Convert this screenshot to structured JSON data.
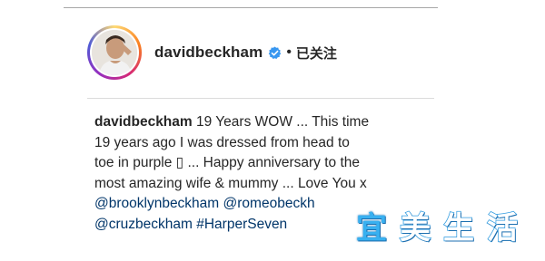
{
  "post": {
    "header": {
      "username": "davidbeckham",
      "verified_icon": "verified-badge-icon",
      "separator": "•",
      "follow_status": "已关注"
    },
    "caption": {
      "author": "davidbeckham",
      "line1_text": " 19 Years WOW ... This time",
      "line2": "19 years ago I was dressed from head to",
      "line3": "toe in purple ▯ ... Happy anniversary to the",
      "line4": "most amazing wife & mummy ... Love You x",
      "line5_tag1": "@brooklynbeckham",
      "line5_tag2": "@romeobeckh",
      "line6_tag1": "@cruzbeckham",
      "line6_tag2": "#HarperSeven"
    }
  },
  "watermark": {
    "chars": [
      "宜",
      "美",
      "生",
      "活"
    ]
  },
  "colors": {
    "text": "#262626",
    "tag": "#003569",
    "verified": "#3897f0",
    "divider": "#dbdbdb"
  }
}
